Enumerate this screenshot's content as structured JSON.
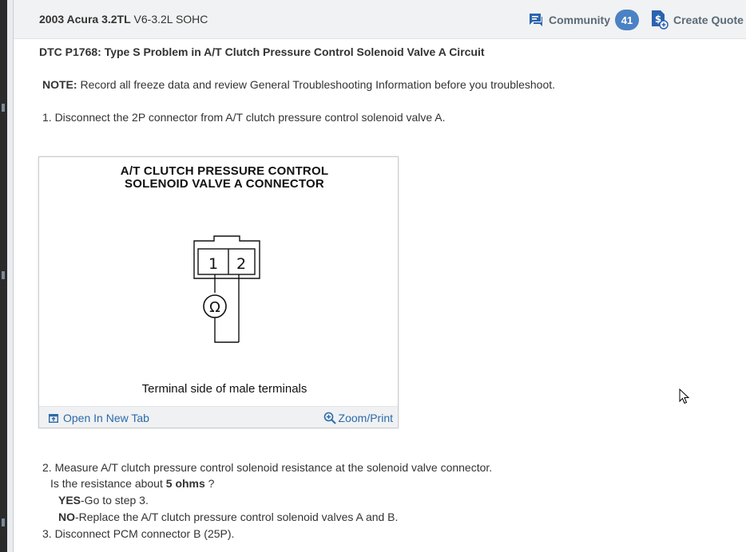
{
  "header": {
    "vehicle_make_model": "2003 Acura 3.2TL",
    "vehicle_engine": "V6-3.2L SOHC",
    "community_label": "Community",
    "community_count": "41",
    "create_quote_label": "Create Quote"
  },
  "content": {
    "dtc_title": "DTC P1768: Type S Problem in A/T Clutch Pressure Control Solenoid Valve A Circuit",
    "note_label": "NOTE:",
    "note_text": " Record all freeze data and review General Troubleshooting Information before you troubleshoot.",
    "step1": "1. Disconnect the 2P connector from A/T clutch pressure control solenoid valve A.",
    "figure": {
      "title_line1": "A/T CLUTCH PRESSURE CONTROL",
      "title_line2": "SOLENOID VALVE A CONNECTOR",
      "terminal_1": "1",
      "terminal_2": "2",
      "ohm_symbol": "Ω",
      "caption": "Terminal side of male terminals",
      "open_tab_label": "Open In New Tab",
      "zoom_label": "Zoom/Print"
    },
    "step2": "2. Measure A/T clutch pressure control solenoid resistance at the solenoid valve connector.",
    "question_prefix": "Is the resistance about ",
    "question_value": "5 ohms",
    "question_suffix": " ?",
    "yes_label": "YES",
    "yes_text": "-Go to step 3.",
    "no_label": "NO",
    "no_text": "-Replace the A/T clutch pressure control solenoid valves A and B.",
    "step3": "3. Disconnect PCM connector B (25P)."
  },
  "icons": {
    "community": "chat-bubble-icon",
    "quote": "dollar-document-icon",
    "open_tab": "open-tab-icon",
    "zoom": "zoom-in-icon"
  },
  "colors": {
    "link": "#2b6aa8",
    "badge": "#4a82c4",
    "header_icon": "#2b63b0"
  }
}
